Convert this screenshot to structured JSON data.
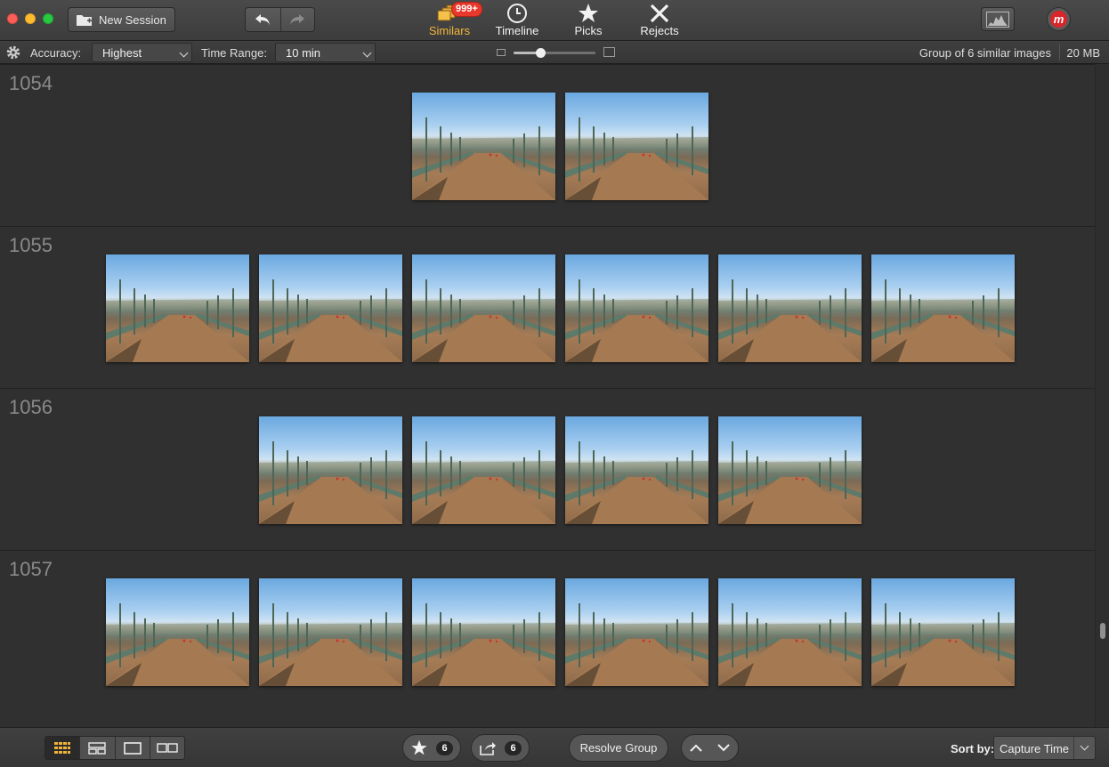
{
  "window": {
    "new_session_label": "New Session"
  },
  "modes": [
    {
      "label": "Similars",
      "icon": "similars-icon",
      "badge": "999+",
      "active": true
    },
    {
      "label": "Timeline",
      "icon": "clock-icon"
    },
    {
      "label": "Picks",
      "icon": "star-icon"
    },
    {
      "label": "Rejects",
      "icon": "x-icon"
    }
  ],
  "toolbar": {
    "accuracy_label": "Accuracy:",
    "accuracy_value": "Highest",
    "time_range_label": "Time Range:",
    "time_range_value": "10 min",
    "zoom_level": 0.33,
    "group_info": "Group of 6 similar images",
    "size_info": "20 MB"
  },
  "groups": [
    {
      "id": "1054",
      "photo_count": 2
    },
    {
      "id": "1055",
      "photo_count": 6
    },
    {
      "id": "1056",
      "photo_count": 4
    },
    {
      "id": "1057",
      "photo_count": 6
    }
  ],
  "bottom": {
    "picks_count": "6",
    "export_count": "6",
    "resolve_label": "Resolve Group",
    "sort_label": "Sort by:",
    "sort_value": "Capture Time"
  },
  "colors": {
    "accent": "#f4b63a",
    "badge": "#e8382b",
    "logo": "#d8262a"
  }
}
